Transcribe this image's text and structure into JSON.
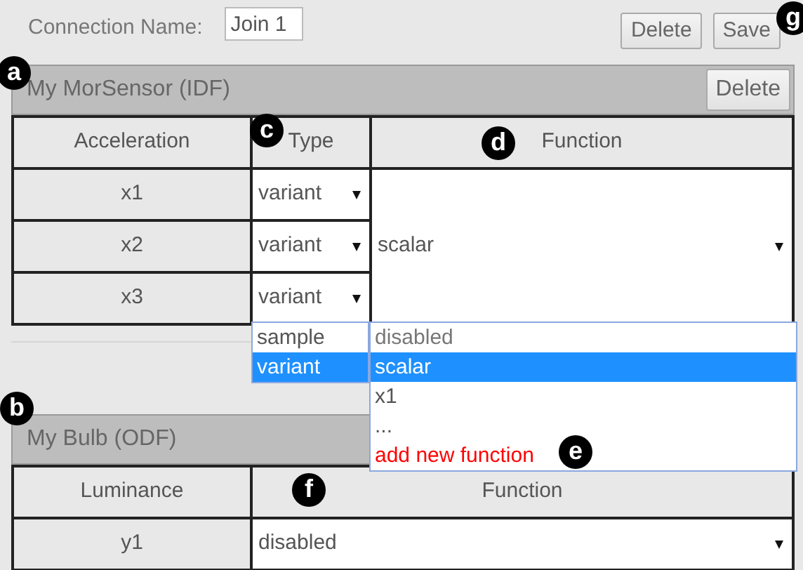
{
  "connection": {
    "label": "Connection Name:",
    "value": "Join 1"
  },
  "toolbar_buttons": [
    "Delete",
    "Save"
  ],
  "devices": [
    {
      "title": "My MorSensor (IDF)",
      "delete_button": "Delete",
      "columns": [
        "Acceleration",
        "Type",
        "Function"
      ],
      "shared_function": "scalar",
      "rows": [
        {
          "name": "x1",
          "type": "variant"
        },
        {
          "name": "x2",
          "type": "variant"
        },
        {
          "name": "x3",
          "type": "variant"
        }
      ]
    },
    {
      "title": "My Bulb (ODF)",
      "columns": [
        "Luminance",
        "Function"
      ],
      "rows": [
        {
          "name": "y1",
          "function": "disabled"
        }
      ]
    }
  ],
  "type_dropdown": {
    "options": [
      {
        "label": "sample",
        "selected": false
      },
      {
        "label": "variant",
        "selected": true
      }
    ]
  },
  "function_dropdown": {
    "options": [
      {
        "label": "disabled",
        "kind": "muted",
        "selected": false
      },
      {
        "label": "scalar",
        "kind": "normal",
        "selected": true
      },
      {
        "label": "x1",
        "kind": "normal",
        "selected": false
      },
      {
        "label": "...",
        "kind": "normal",
        "selected": false
      },
      {
        "label": "add new function",
        "kind": "action",
        "selected": false
      }
    ]
  },
  "callouts": [
    "a",
    "b",
    "c",
    "d",
    "e",
    "f",
    "g"
  ]
}
